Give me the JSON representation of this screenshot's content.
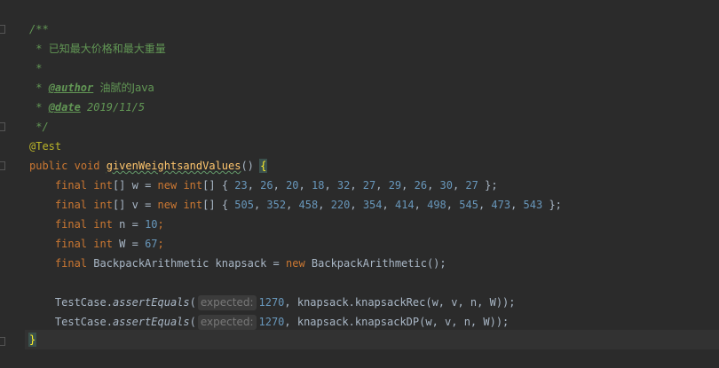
{
  "doc": {
    "open": "/**",
    "desc_star": " * ",
    "desc": "已知最大价格和最大重量",
    "blank_star": " *",
    "author_star": " * ",
    "author_tag": "@author",
    "author_name": "油腻的Java",
    "date_star": " * ",
    "date_tag": "@date",
    "date_value": "2019/11/5",
    "close": " */"
  },
  "annotation": "@Test",
  "method": {
    "mod": "public",
    "type": "void",
    "name": "givenWeightsandValues",
    "parens": "()",
    "brace": "{"
  },
  "lines": {
    "w": {
      "final": "final",
      "type": "int",
      "decl": "[] w = ",
      "new": "new",
      "type2": "int",
      "open": "[] { ",
      "values": [
        "23",
        "26",
        "20",
        "18",
        "32",
        "27",
        "29",
        "26",
        "30",
        "27"
      ],
      "close": " };"
    },
    "v": {
      "final": "final",
      "type": "int",
      "decl": "[] v = ",
      "new": "new",
      "type2": "int",
      "open": "[] { ",
      "values": [
        "505",
        "352",
        "458",
        "220",
        "354",
        "414",
        "498",
        "545",
        "473",
        "543"
      ],
      "close": " };"
    },
    "n": {
      "final": "final",
      "type": "int",
      "decl": " n = ",
      "value": "10",
      "end": ";"
    },
    "W": {
      "final": "final",
      "type": "int",
      "decl": " W = ",
      "value": "67",
      "end": ";"
    },
    "knap": {
      "final": "final",
      "decl": " BackpackArithmetic knapsack = ",
      "new": "new",
      "ctor": " BackpackArithmetic();"
    },
    "assert1": {
      "cls": "TestCase.",
      "method": "assertEquals",
      "open": "(",
      "hint": "expected:",
      "value": "1270",
      "rest": ", knapsack.knapsackRec(w, v, n, W));"
    },
    "assert2": {
      "cls": "TestCase.",
      "method": "assertEquals",
      "open": "(",
      "hint": "expected:",
      "value": "1270",
      "rest": ", knapsack.knapsackDP(w, v, n, W));"
    },
    "close": "}"
  },
  "colors": {
    "background": "#2b2b2b",
    "keyword": "#cc7832",
    "doc": "#629755",
    "number": "#6897bb",
    "method": "#ffc66d",
    "annotation": "#bbb529",
    "text": "#a9b7c6"
  }
}
